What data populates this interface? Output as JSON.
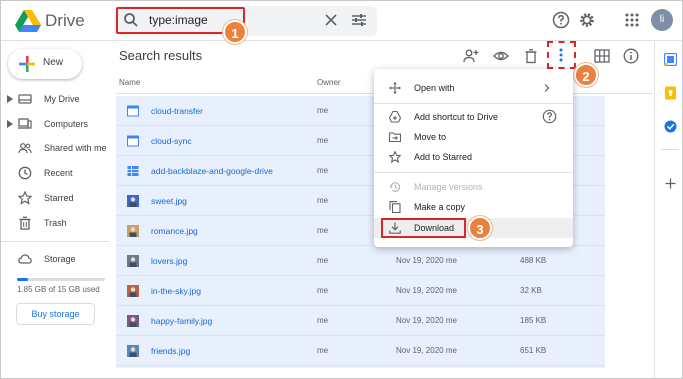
{
  "app": {
    "brand": "Drive"
  },
  "search": {
    "query": "type:image"
  },
  "account": {
    "initials": "li"
  },
  "badges": {
    "one": "1",
    "two": "2",
    "three": "3"
  },
  "sidebar": {
    "new_label": "New",
    "items": [
      {
        "label": "My Drive",
        "icon": "drive-icon",
        "expandable": true
      },
      {
        "label": "Computers",
        "icon": "computer-icon",
        "expandable": true
      },
      {
        "label": "Shared with me",
        "icon": "people-icon",
        "expandable": false
      },
      {
        "label": "Recent",
        "icon": "clock-icon",
        "expandable": false
      },
      {
        "label": "Starred",
        "icon": "star-icon",
        "expandable": false
      },
      {
        "label": "Trash",
        "icon": "trash-icon",
        "expandable": false
      }
    ],
    "storage_label": "Storage",
    "storage_text": "1.85 GB of 15 GB used",
    "storage_fraction": 0.123,
    "buy_label": "Buy storage"
  },
  "main": {
    "title": "Search results",
    "columns": {
      "name": "Name",
      "owner": "Owner"
    },
    "files": [
      {
        "name": "cloud-transfer",
        "owner": "me",
        "date": "",
        "size": "",
        "type": "doc"
      },
      {
        "name": "cloud-sync",
        "owner": "me",
        "date": "",
        "size": "",
        "type": "doc"
      },
      {
        "name": "add-backblaze-and-google-drive",
        "owner": "me",
        "date": "",
        "size": "",
        "type": "sheet"
      },
      {
        "name": "sweet.jpg",
        "owner": "me",
        "date": "",
        "size": "",
        "type": "image"
      },
      {
        "name": "romance.jpg",
        "owner": "me",
        "date": "",
        "size": "",
        "type": "image"
      },
      {
        "name": "lovers.jpg",
        "owner": "me",
        "date": "Nov 19, 2020 me",
        "size": "488 KB",
        "type": "image"
      },
      {
        "name": "in-the-sky.jpg",
        "owner": "me",
        "date": "Nov 19, 2020 me",
        "size": "32 KB",
        "type": "image"
      },
      {
        "name": "happy-family.jpg",
        "owner": "me",
        "date": "Nov 19, 2020 me",
        "size": "185 KB",
        "type": "image"
      },
      {
        "name": "friends.jpg",
        "owner": "me",
        "date": "Nov 19, 2020 me",
        "size": "651 KB",
        "type": "image"
      }
    ]
  },
  "menu": {
    "items": [
      {
        "label": "Open with",
        "icon": "move-arrows-icon"
      },
      {
        "label": "Add shortcut to Drive",
        "icon": "shortcut-icon"
      },
      {
        "label": "Move to",
        "icon": "folder-move-icon"
      },
      {
        "label": "Add to Starred",
        "icon": "star-icon"
      },
      {
        "label": "Manage versions",
        "icon": "history-icon"
      },
      {
        "label": "Make a copy",
        "icon": "copy-icon"
      },
      {
        "label": "Download",
        "icon": "download-icon"
      }
    ]
  },
  "colors": {
    "accent": "#1a73e8",
    "highlight": "#d9262a",
    "badge": "#e8823e",
    "selection": "#e8f0fe"
  }
}
